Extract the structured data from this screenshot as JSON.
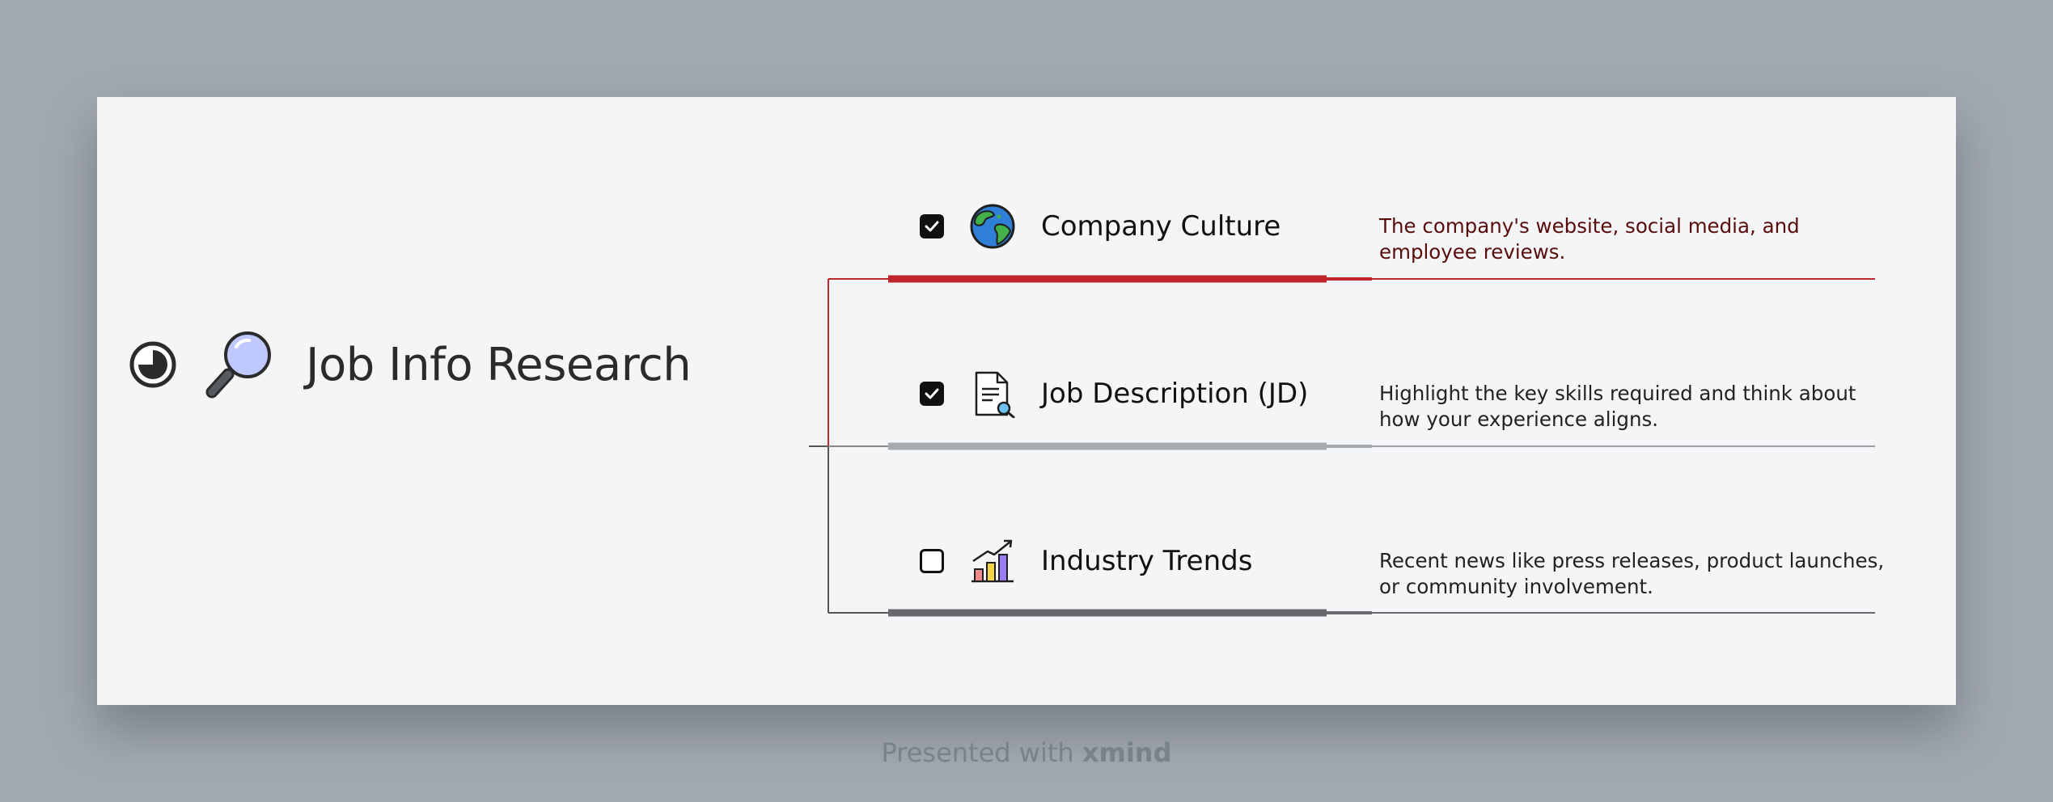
{
  "root": {
    "title": "Job Info Research",
    "icons": [
      "progress-three-quarter-icon",
      "magnifier-icon"
    ]
  },
  "branches": [
    {
      "label": "Company Culture",
      "checked": true,
      "icon": "globe-icon",
      "note": "The company's website, social media, and employee reviews.",
      "color": "#c0272d"
    },
    {
      "label": "Job Description (JD)",
      "checked": true,
      "icon": "document-search-icon",
      "note": "Highlight the key skills required and think about how your experience aligns.",
      "color": "#a7abb0"
    },
    {
      "label": "Industry Trends",
      "checked": false,
      "icon": "bar-chart-trend-icon",
      "note": "Recent news like press releases, product launches, or community involvement.",
      "color": "#67696d"
    }
  ],
  "footer": {
    "prefix": "Presented with ",
    "brand": "xmind"
  },
  "colors": {
    "background": "#a3a9b1",
    "card": "#f4f5f7",
    "accent_red": "#c0272d"
  }
}
